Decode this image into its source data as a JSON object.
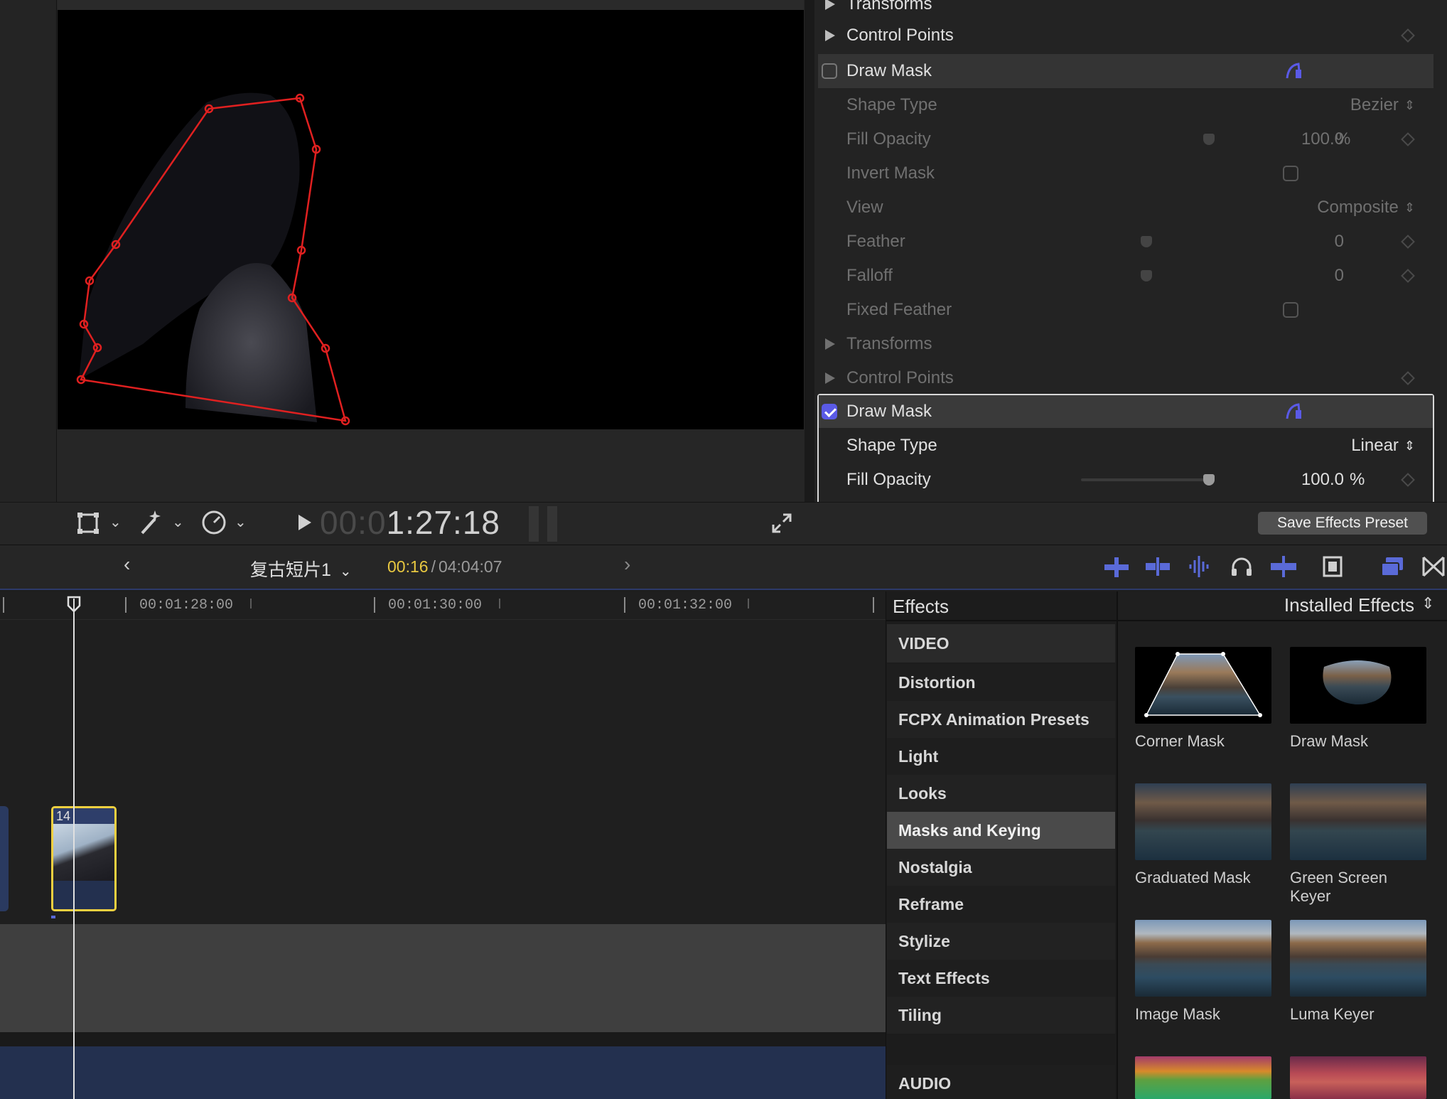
{
  "inspector": {
    "rows": [
      {
        "label": "Transforms"
      },
      {
        "label": "Control Points"
      },
      {
        "label": "Draw Mask"
      },
      {
        "label": "Shape Type",
        "value": "Bezier"
      },
      {
        "label": "Fill Opacity",
        "value": "100.0",
        "unit": "%"
      },
      {
        "label": "Invert Mask"
      },
      {
        "label": "View",
        "value": "Composite"
      },
      {
        "label": "Feather",
        "value": "0"
      },
      {
        "label": "Falloff",
        "value": "0"
      },
      {
        "label": "Fixed Feather"
      },
      {
        "label": "Transforms"
      },
      {
        "label": "Control Points"
      },
      {
        "label": "Draw Mask"
      },
      {
        "label": "Shape Type",
        "value": "Linear"
      },
      {
        "label": "Fill Opacity",
        "value": "100.0",
        "unit": "%"
      }
    ],
    "fill_opacity_fraction": 1.0,
    "save_preset_label": "Save Effects Preset"
  },
  "transport": {
    "timecode_dim": "00:0",
    "timecode_bright": "1:27:18"
  },
  "timeline": {
    "project_name": "复古短片1",
    "position": "00:16",
    "separator": "/",
    "duration": "04:04:07",
    "ruler": [
      "00:01:28:00",
      "00:01:30:00",
      "00:01:32:00"
    ],
    "clip_number": "14"
  },
  "effects": {
    "title": "Effects",
    "filter": "Installed Effects",
    "categories": [
      "VIDEO",
      "Distortion",
      "FCPX Animation Presets",
      "Light",
      "Looks",
      "Masks and Keying",
      "Nostalgia",
      "Reframe",
      "Stylize",
      "Text Effects",
      "Tiling",
      "AUDIO"
    ],
    "selected_category": "Masks and Keying",
    "items": [
      {
        "label": "Corner Mask"
      },
      {
        "label": "Draw Mask"
      },
      {
        "label": "Graduated Mask"
      },
      {
        "label": "Green Screen Keyer"
      },
      {
        "label": "Image Mask"
      },
      {
        "label": "Luma Keyer"
      }
    ]
  },
  "colors": {
    "accent": "#5a5ae6",
    "mask_outline": "#e02020",
    "clip_border": "#f0d040",
    "timecode_yellow": "#e8c840"
  }
}
